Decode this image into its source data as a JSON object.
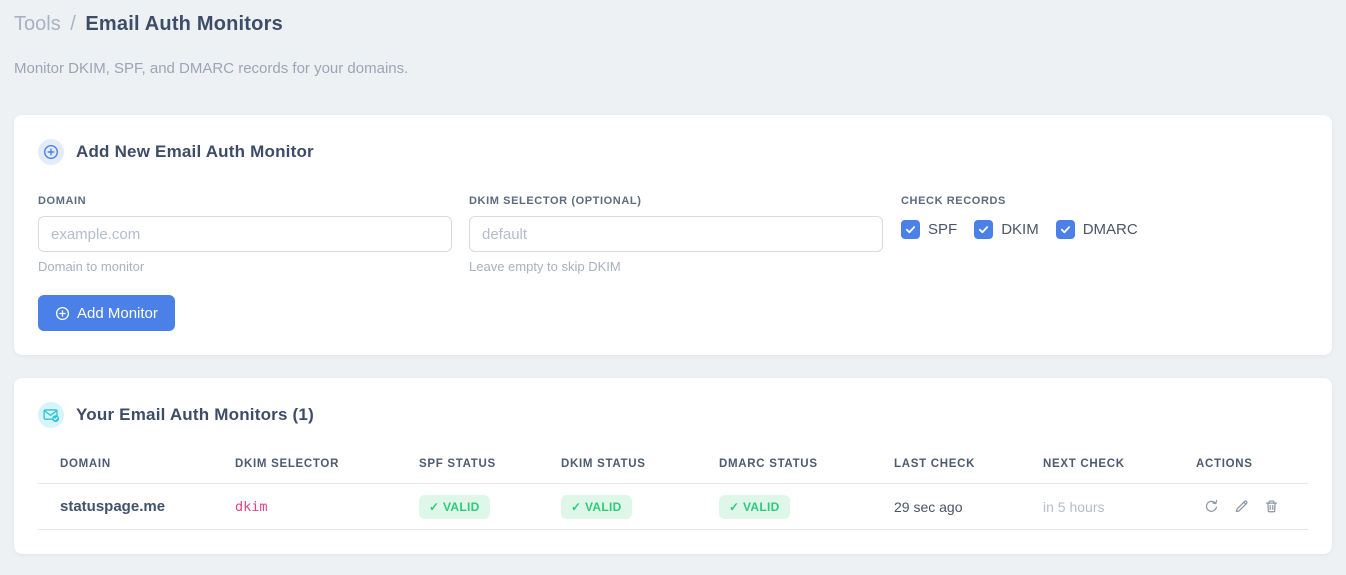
{
  "page": {
    "breadcrumb_root": "Tools",
    "breadcrumb_sep": "/",
    "title": "Email Auth Monitors",
    "subtitle": "Monitor DKIM, SPF, and DMARC records for your domains."
  },
  "add_form": {
    "title": "Add New Email Auth Monitor",
    "domain_label": "DOMAIN",
    "domain_placeholder": "example.com",
    "domain_value": "",
    "domain_hint": "Domain to monitor",
    "selector_label": "DKIM SELECTOR (OPTIONAL)",
    "selector_placeholder": "default",
    "selector_value": "",
    "selector_hint": "Leave empty to skip DKIM",
    "check_records_label": "CHECK RECORDS",
    "checkboxes": [
      {
        "label": "SPF",
        "checked": true
      },
      {
        "label": "DKIM",
        "checked": true
      },
      {
        "label": "DMARC",
        "checked": true
      }
    ],
    "submit_label": "Add Monitor"
  },
  "monitors": {
    "title": "Your Email Auth Monitors (1)",
    "columns": [
      "DOMAIN",
      "DKIM SELECTOR",
      "SPF STATUS",
      "DKIM STATUS",
      "DMARC STATUS",
      "LAST CHECK",
      "NEXT CHECK",
      "ACTIONS"
    ],
    "rows": [
      {
        "domain": "statuspage.me",
        "dkim_selector": "dkim",
        "spf_status": "✓ VALID",
        "dkim_status": "✓ VALID",
        "dmarc_status": "✓ VALID",
        "last_check": "29 sec ago",
        "next_check": "in 5 hours"
      }
    ]
  },
  "icons": {
    "add_card": "plus-circle-icon",
    "monitors_card": "envelope-check-icon",
    "button": "plus-circle-icon",
    "checkbox": "check-icon",
    "row_actions": [
      "refresh-icon",
      "pencil-icon",
      "trash-icon"
    ]
  },
  "colors": {
    "accent_blue": "#4a80e8",
    "teal": "#2bc3d8",
    "pink_code": "#e83e8c",
    "badge_bg": "#def7e9",
    "badge_text": "#2ecb7d",
    "page_bg": "#eef1f4"
  }
}
